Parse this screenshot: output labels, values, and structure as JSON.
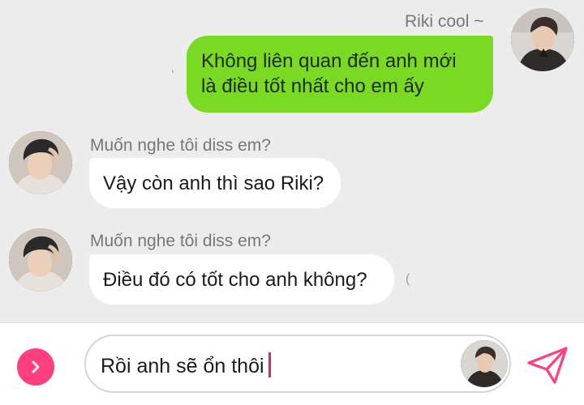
{
  "conversation": {
    "messages": [
      {
        "direction": "outgoing",
        "sender": "Riki cool ~",
        "avatar_icon": "user-avatar-riki",
        "text_line1": "Không liên quan đến anh mới",
        "text_line2": "là điều tốt nhất cho em ấy"
      },
      {
        "direction": "incoming",
        "sender": "Muốn nghe tôi diss em?",
        "avatar_icon": "user-avatar-contact",
        "text": "Vậy còn anh thì sao Riki?"
      },
      {
        "direction": "incoming",
        "sender": "Muốn nghe tôi diss em?",
        "avatar_icon": "user-avatar-contact",
        "text": "Điều đó có tốt cho anh không?"
      }
    ]
  },
  "composer": {
    "input_value": "Rồi anh sẽ ổn thôi",
    "expand_icon": "chevron-right-icon",
    "send_icon": "send-paper-plane-icon",
    "accent_color": "#ff3f7f"
  },
  "colors": {
    "outgoing_bubble": "#79d923",
    "incoming_bubble": "#ffffff",
    "background": "#ececec"
  }
}
